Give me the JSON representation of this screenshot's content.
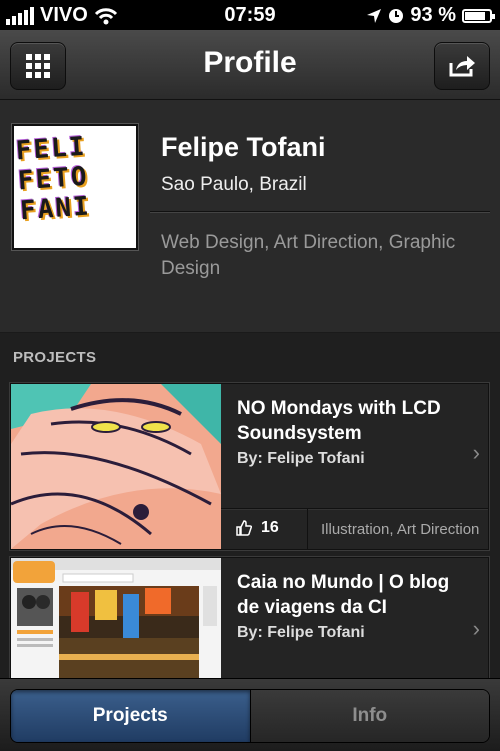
{
  "status_bar": {
    "carrier": "VIVO",
    "time": "07:59",
    "battery": "93 %",
    "battery_level": 0.93
  },
  "nav": {
    "title": "Profile",
    "left_icon": "grid-icon",
    "right_icon": "share-icon"
  },
  "profile": {
    "avatar_text": [
      "FELI",
      "FETO",
      "FANI"
    ],
    "name": "Felipe Tofani",
    "location": "Sao Paulo, Brazil",
    "fields": "Web Design, Art Direction, Graphic Design"
  },
  "projects": {
    "section_title": "PROJECTS",
    "items": [
      {
        "title": "NO Mondays with LCD Soundsystem",
        "author": "By: Felipe Tofani",
        "appreciations": "16",
        "tags": "Illustration, Art Direction"
      },
      {
        "title": "Caia no Mundo | O blog de viagens da CI",
        "author": "By: Felipe Tofani"
      }
    ]
  },
  "tabs": {
    "projects": "Projects",
    "info": "Info"
  },
  "colors": {
    "active_tab": "#2e4d77",
    "background": "#1f1f1f"
  }
}
